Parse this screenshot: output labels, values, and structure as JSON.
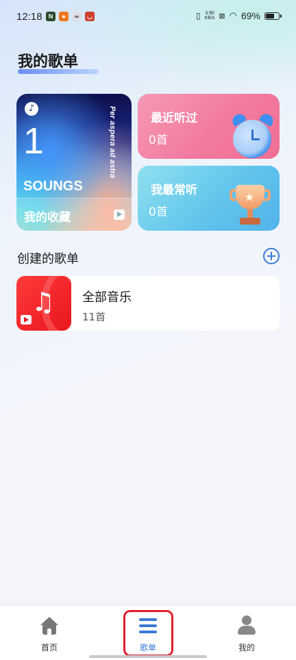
{
  "status_bar": {
    "time": "12:18",
    "network_speed_value": "3.90",
    "network_speed_unit": "KB/s",
    "battery": "69%",
    "battery_level": 0.69
  },
  "page": {
    "title": "我的歌单"
  },
  "favorites_card": {
    "count": "1",
    "tagline": "Per aspera ad astra",
    "brand": "SOUNGS",
    "label": "我的收藏"
  },
  "recent_card": {
    "title": "最近听过",
    "count": "0首"
  },
  "frequent_card": {
    "title": "我最常听",
    "count": "0首"
  },
  "created_section": {
    "title": "创建的歌单"
  },
  "playlists": [
    {
      "name": "全部音乐",
      "count": "11首"
    }
  ],
  "bottom_nav": {
    "items": [
      {
        "label": "首页",
        "icon": "home-icon"
      },
      {
        "label": "歌单",
        "icon": "list-icon",
        "active": true
      },
      {
        "label": "我的",
        "icon": "person-icon"
      }
    ]
  },
  "colors": {
    "accent": "#3a7bd5",
    "recent_card": "#f37a9e",
    "frequent_card": "#5fc3ec",
    "playlist_cover": "#e8161e",
    "highlight": "#e0202a"
  }
}
